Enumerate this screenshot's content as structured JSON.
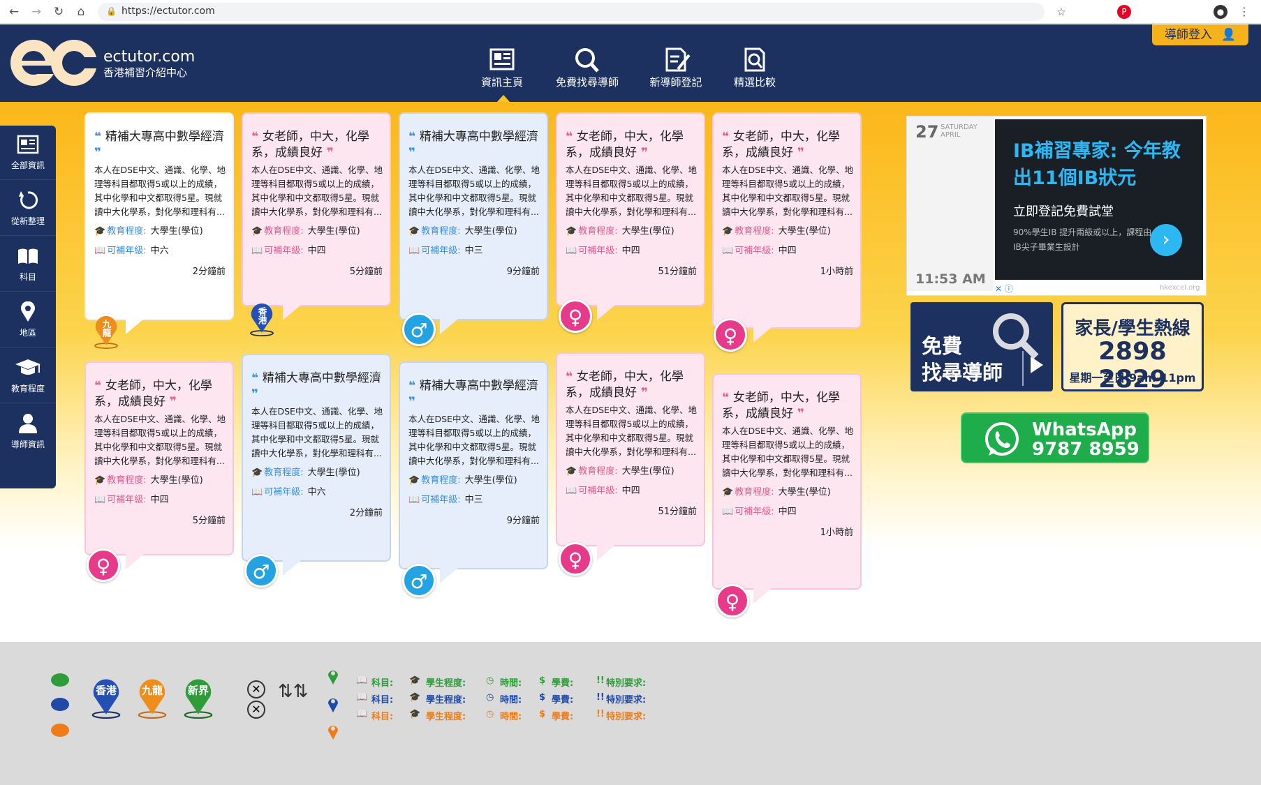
{
  "browser": {
    "url": "https://ectutor.com"
  },
  "header": {
    "logo_mark": "ec",
    "logo_domain": "ectutor.com",
    "logo_subtitle": "香港補習介紹中心",
    "login": "導師登入",
    "nav": [
      {
        "label": "資訊主頁",
        "icon": "news-icon"
      },
      {
        "label": "免費找尋導師",
        "icon": "search-icon"
      },
      {
        "label": "新導師登記",
        "icon": "register-icon"
      },
      {
        "label": "精選比較",
        "icon": "compare-icon"
      }
    ]
  },
  "sidebar": [
    {
      "label": "全部資訊",
      "icon": "news-icon"
    },
    {
      "label": "從新整理",
      "icon": "refresh-icon"
    },
    {
      "label": "科目",
      "icon": "book-icon"
    },
    {
      "label": "地區",
      "icon": "location-pin-icon"
    },
    {
      "label": "教育程度",
      "icon": "graduation-cap-icon"
    },
    {
      "label": "導師資訊",
      "icon": "user-icon"
    }
  ],
  "labels": {
    "edu": "教育程度:",
    "grade": "可補年級:"
  },
  "cards": [
    {
      "title": "精補大專高中數學經濟",
      "desc": "本人在DSE中文、通識、化學、地理等科目都取得5或以上的成績，其中化學和中文都取得5星。現就讀中大化學系，對化學和理科有...",
      "edu": "大學生(學位)",
      "grade": "中六",
      "time": "2分鐘前",
      "badge": "九龍"
    },
    {
      "title": "女老師，中大，化學系，成績良好",
      "desc": "本人在DSE中文、通識、化學、地理等科目都取得5或以上的成績，其中化學和中文都取得5星。現就讀中大化學系，對化學和理科有...",
      "edu": "大學生(學位)",
      "grade": "中四",
      "time": "5分鐘前",
      "badge": "香港"
    },
    {
      "title": "精補大專高中數學經濟",
      "desc": "本人在DSE中文、通識、化學、地理等科目都取得5或以上的成績，其中化學和中文都取得5星。現就讀中大化學系，對化學和理科有...",
      "edu": "大學生(學位)",
      "grade": "中三",
      "time": "9分鐘前",
      "badge": "♂"
    },
    {
      "title": "女老師，中大，化學系，成績良好",
      "desc": "本人在DSE中文、通識、化學、地理等科目都取得5或以上的成績，其中化學和中文都取得5星。現就讀中大化學系，對化學和理科有...",
      "edu": "大學生(學位)",
      "grade": "中四",
      "time": "51分鐘前",
      "badge": "♀"
    },
    {
      "title": "女老師，中大，化學系，成績良好",
      "desc": "本人在DSE中文、通識、化學、地理等科目都取得5或以上的成績，其中化學和中文都取得5星。現就讀中大化學系，對化學和理科有...",
      "edu": "大學生(學位)",
      "grade": "中四",
      "time": "1小時前",
      "badge": "♀"
    },
    {
      "title": "女老師，中大，化學系，成績良好",
      "desc": "本人在DSE中文、通識、化學、地理等科目都取得5或以上的成績，其中化學和中文都取得5星。現就讀中大化學系，對化學和理科有...",
      "edu": "大學生(學位)",
      "grade": "中四",
      "time": "5分鐘前",
      "badge": "♀"
    },
    {
      "title": "精補大專高中數學經濟",
      "desc": "本人在DSE中文、通識、化學、地理等科目都取得5或以上的成績，其中化學和中文都取得5星。現就讀中大化學系，對化學和理科有...",
      "edu": "大學生(學位)",
      "grade": "中六",
      "time": "2分鐘前",
      "badge": "♂"
    },
    {
      "title": "精補大專高中數學經濟",
      "desc": "本人在DSE中文、通識、化學、地理等科目都取得5或以上的成績，其中化學和中文都取得5星。現就讀中大化學系，對化學和理科有...",
      "edu": "大學生(學位)",
      "grade": "中三",
      "time": "9分鐘前",
      "badge": "♂"
    },
    {
      "title": "女老師，中大，化學系，成績良好",
      "desc": "本人在DSE中文、通識、化學、地理等科目都取得5或以上的成績，其中化學和中文都取得5星。現就讀中大化學系，對化學和理科有...",
      "edu": "大學生(學位)",
      "grade": "中四",
      "time": "51分鐘前",
      "badge": "♀"
    },
    {
      "title": "女老師，中大，化學系，成績良好",
      "desc": "本人在DSE中文、通識、化學、地理等科目都取得5或以上的成績，其中化學和中文都取得5星。現就讀中大化學系，對化學和理科有...",
      "edu": "大學生(學位)",
      "grade": "中四",
      "time": "1小時前",
      "badge": "♀"
    }
  ],
  "ad": {
    "day": "27",
    "weekday": "SATURDAY",
    "month": "APRIL",
    "clock": "11:53  AM",
    "headline": "IB補習專家: 今年教出11個IB狀元",
    "subline": "立即登記免費試堂",
    "body": "90%學生IB 提升兩級或以上，課程由IB尖子畢業生設計",
    "source": "hkexcel.org"
  },
  "promo": {
    "find_l1": "免費",
    "find_l2": "找尋導師",
    "hotline_title": "家長/學生熱線",
    "hotline_number": "2898 2829",
    "hotline_hours": "星期一至日 9am-11pm",
    "wa_l1": "WhatsApp",
    "wa_l2": "9787 8959"
  },
  "footer": {
    "pins": [
      "香港",
      "九龍",
      "新界"
    ],
    "legend": [
      "科目:",
      "學生程度:",
      "時間:",
      "學費:",
      "特別要求:"
    ],
    "colors": [
      "#2f9c3a",
      "#1f4aa8",
      "#ef7c17"
    ]
  },
  "colors": {
    "navy": "#1d3160",
    "accent": "#f6b21b",
    "female": "#e83a8a",
    "male": "#24a3e3",
    "whatsapp": "#1ead4a"
  }
}
